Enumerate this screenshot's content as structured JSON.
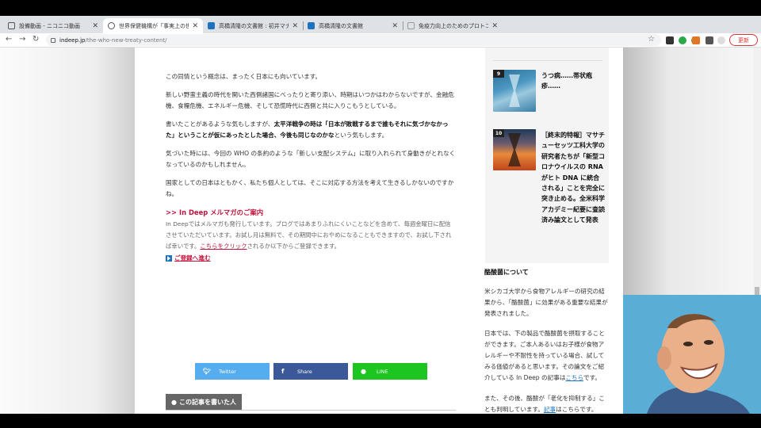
{
  "browser": {
    "tabs": [
      {
        "title": "設備動画 - ニコニコ動画",
        "favicon_color": "#555555",
        "active": false
      },
      {
        "title": "世界保健機構が「事実上の世界政府",
        "favicon_color": "#555555",
        "active": true
      },
      {
        "title": "高橋清隆の文書館 : 初井マナーの",
        "favicon_color": "#1e73be",
        "active": false
      },
      {
        "title": "高橋清隆の文書館",
        "favicon_color": "#1e73be",
        "active": false
      },
      {
        "title": "免疫力向上のためのプロトコル",
        "favicon_color": "#999999",
        "active": false
      }
    ],
    "address": {
      "host": "indeep.jp",
      "path": "/the-who-new-treaty-content/"
    },
    "update_label": "更新"
  },
  "article": {
    "p1": "この同情という概念は、まったく日本にも向いています。",
    "p2": "新しい野蛮主義の時代を開いた西側諸国にべったりと寄り添い、時期はいつかはわからないですが、金融危機、食糧危機、エネルギー危機、そして恐慌時代に西側と共に入りこもうとしている。",
    "p3_bold": "太平洋戦争の時は「日本が敗戦するまで誰もそれに気づかなかった」ということが仮にあったとした場合、今後も同じなのかな",
    "p3_pre": "書いたことがあるような気もしますが、",
    "p3_post": "という気もします。",
    "p4": "気づいた時には、今回の WHO の条約のような「新しい支配システム」に取り入れられて身動きがとれなくなっているのかもしれません。",
    "p5": "国家としての日本はともかく、私たち個人としては、そこに対応する方法を考えて生きるしかないのですかね。",
    "mm_heading": ">> In Deep メルマガのご案内",
    "mm_body_1": "In Deepではメルマガも発行しています。ブログではあまりふれにくいことなどを含めて、毎週金曜日に配信させていただいています。お試し月は無料で、その期間中におやめになることもできますので、お試し下されば幸いです。",
    "mm_link": "こちらをクリック",
    "mm_body_2": "されるか以下からご登録できます。",
    "register": "ご登録へ進む",
    "share": [
      {
        "label": "Twitter",
        "icon": "twitter-bird",
        "color": "#55acee"
      },
      {
        "label": "Share",
        "icon": "facebook-f",
        "color": "#3b5998"
      },
      {
        "label": "LINE",
        "icon": "line-bubble",
        "color": "#1dc520"
      }
    ],
    "author_heading": "この記事を書いた人"
  },
  "sidebar": {
    "ranking": [
      {
        "rank": "9",
        "title": "うつ病……帯状疱疹……"
      },
      {
        "rank": "10",
        "title": "［終末的特報］マサチューセッツ工科大学の研究者たちが「新型コロナウイルスの RNA がヒト DNA に統合される」ことを完全に突き止める。全米科学アカデミー紀要に査読済み論文として発表"
      }
    ],
    "heading": "酪酸菌について",
    "p1": "米シカゴ大学から食物アレルギーの研究の結果から、「酪酸菌」に効果がある重要な結果が発表されました。",
    "p2_pre": "日本では、下の製品で酪酸菌を摂取することができます。ご本人あるいはお子様が食物アレルギーや不耐性を持っている場合、試してみる価値があると思います。その論文をご紹介している In Deep の記事は",
    "p2_link": "こちら",
    "p2_post": "です。",
    "p3_pre": "また、その後、酪酸が「老化を抑制する」ことも判明しています。",
    "p3_link": "記事",
    "p3_post": "はこちらです。"
  }
}
